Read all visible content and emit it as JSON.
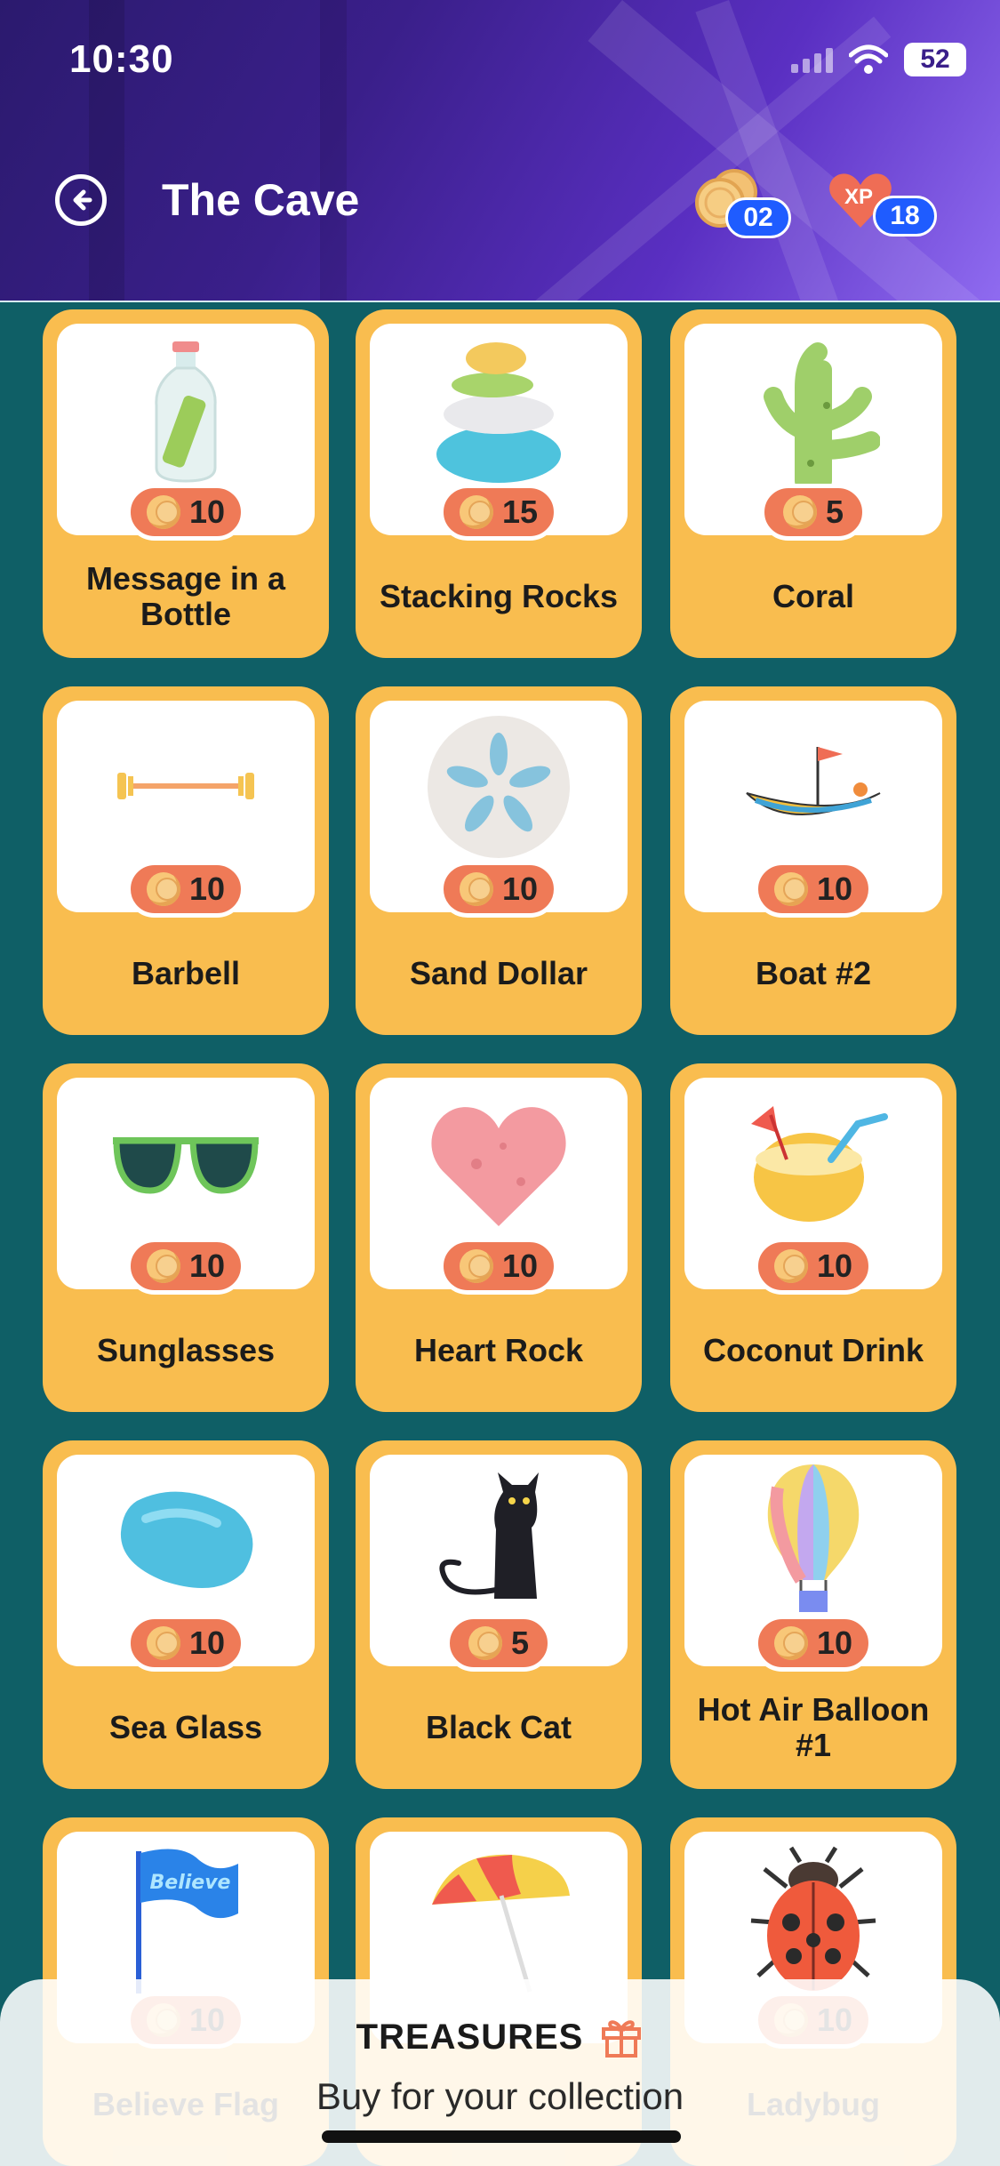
{
  "status_bar": {
    "time": "10:30",
    "battery": "52"
  },
  "header": {
    "title": "The Cave",
    "coins": "02",
    "xp_label": "XP",
    "xp": "18"
  },
  "colors": {
    "card": "#f9bd4f",
    "price_pill": "#ef7a57",
    "background": "#0f5f66",
    "badge": "#1f5cff"
  },
  "items": [
    {
      "name": "Message in a Bottle",
      "price": "10",
      "icon": "bottle-icon"
    },
    {
      "name": "Stacking Rocks",
      "price": "15",
      "icon": "stacking-rocks-icon"
    },
    {
      "name": "Coral",
      "price": "5",
      "icon": "coral-icon"
    },
    {
      "name": "Barbell",
      "price": "10",
      "icon": "barbell-icon"
    },
    {
      "name": "Sand Dollar",
      "price": "10",
      "icon": "sand-dollar-icon"
    },
    {
      "name": "Boat #2",
      "price": "10",
      "icon": "boat-icon"
    },
    {
      "name": "Sunglasses",
      "price": "10",
      "icon": "sunglasses-icon"
    },
    {
      "name": "Heart Rock",
      "price": "10",
      "icon": "heart-rock-icon"
    },
    {
      "name": "Coconut Drink",
      "price": "10",
      "icon": "coconut-drink-icon"
    },
    {
      "name": "Sea Glass",
      "price": "10",
      "icon": "sea-glass-icon"
    },
    {
      "name": "Black Cat",
      "price": "5",
      "icon": "black-cat-icon"
    },
    {
      "name": "Hot Air Balloon #1",
      "price": "10",
      "icon": "hot-air-balloon-icon"
    },
    {
      "name": "Believe Flag",
      "price": "10",
      "icon": "flag-icon",
      "flag_text": "Believe"
    },
    {
      "name": "",
      "price": "",
      "icon": "umbrella-icon"
    },
    {
      "name": "Ladybug",
      "price": "10",
      "icon": "ladybug-icon"
    }
  ],
  "sheet": {
    "title": "TREASURES",
    "subtitle": "Buy for your collection",
    "icon": "gift-icon"
  }
}
